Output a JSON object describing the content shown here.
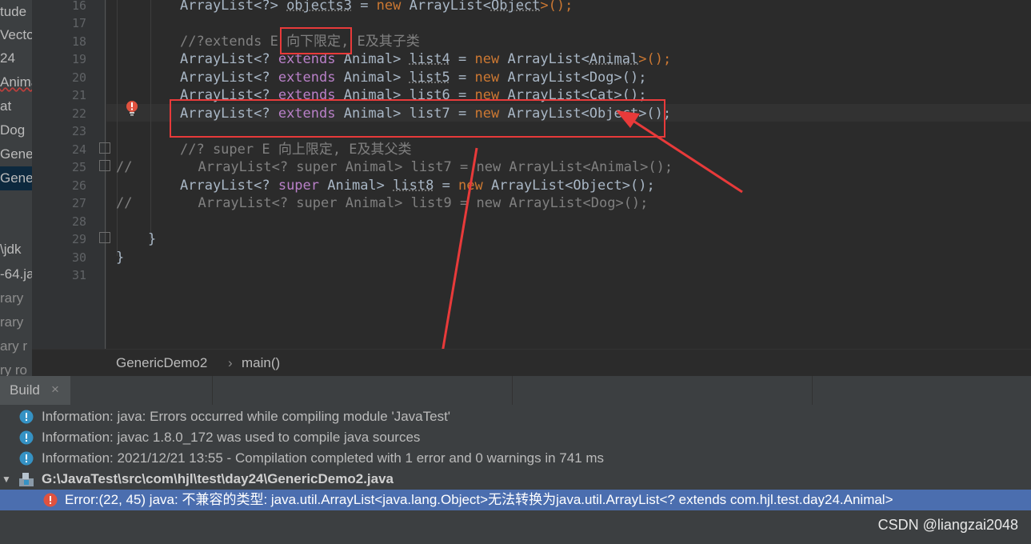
{
  "project_tree": {
    "items": [
      "tude",
      "Vecto",
      "24",
      "Anima",
      "at",
      "Dog",
      "Gener",
      "Gener",
      "\\jdk",
      "-64.ja",
      "rary",
      "rary",
      "ary r",
      "ry ro"
    ]
  },
  "editor": {
    "line_numbers": [
      "16",
      "17",
      "18",
      "19",
      "20",
      "21",
      "22",
      "23",
      "24",
      "25",
      "26",
      "27",
      "28",
      "29",
      "30",
      "31"
    ],
    "lines": {
      "l16a": "ArrayList<?> ",
      "l16b": "objects3",
      "l16c": " = ",
      "l16d": "new",
      "l16e": " ArrayList<",
      "l16f": "Object",
      "l16g": ">();",
      "l18a": "//?extends E ",
      "l18b": "向下限定",
      "l18c": ", E及其子类",
      "l19a": "ArrayList<? ",
      "l19b": "extends",
      "l19c": " Animal> ",
      "l19d": "list4",
      "l19e": " = ",
      "l19f": "new",
      "l19g": " ArrayList<",
      "l19h": "Animal",
      "l19i": ">();",
      "l20a": "ArrayList<? ",
      "l20b": "extends",
      "l20c": " Animal> ",
      "l20d": "list5",
      "l20e": " = ",
      "l20f": "new",
      "l20g": " ArrayList<Dog>();",
      "l21a": "ArrayList<? ",
      "l21b": "extends",
      "l21c": " Animal> ",
      "l21d": "list6",
      "l21e": " = ",
      "l21f": "new",
      "l21g": " ArrayList<Cat>();",
      "l22a": "ArrayList<? ",
      "l22b": "extends",
      "l22c": " Animal> list7 = ",
      "l22d": "new",
      "l22e": " ArrayList<Object>();",
      "l24": "//? super E 向上限定, E及其父类",
      "l25a": "//",
      "l25b": "ArrayList<? super Animal> list7 = new ArrayList<Animal>();",
      "l26a": "ArrayList<? ",
      "l26b": "super",
      "l26c": " Animal> ",
      "l26d": "list8",
      "l26e": " = ",
      "l26f": "new",
      "l26g": " ArrayList<Object>();",
      "l27a": "//",
      "l27b": "ArrayList<? super Animal> list9 = new ArrayList<Dog>();",
      "l29": "}",
      "l30": "}"
    }
  },
  "breadcrumb": {
    "file": "GenericDemo2",
    "sep": "›",
    "method": "main()"
  },
  "build": {
    "tab_label": "Build",
    "tab_close": "×",
    "messages": [
      "Information: java: Errors occurred while compiling module 'JavaTest'",
      "Information: javac 1.8.0_172 was used to compile java sources",
      "Information: 2021/12/21 13:55 - Compilation completed with 1 error and 0 warnings in 741 ms"
    ],
    "file_path": "G:\\JavaTest\\src\\com\\hjl\\test\\day24\\GenericDemo2.java",
    "error": "Error:(22, 45)  java: 不兼容的类型: java.util.ArrayList<java.lang.Object>无法转换为java.util.ArrayList<? extends com.hjl.test.day24.Animal>"
  },
  "watermark": "CSDN @liangzai2048",
  "colors": {
    "annotation_red": "#e83a3a",
    "selection_blue": "#4b6eaf",
    "keyword_orange": "#cc7832",
    "extends_purple": "#b980c8"
  }
}
